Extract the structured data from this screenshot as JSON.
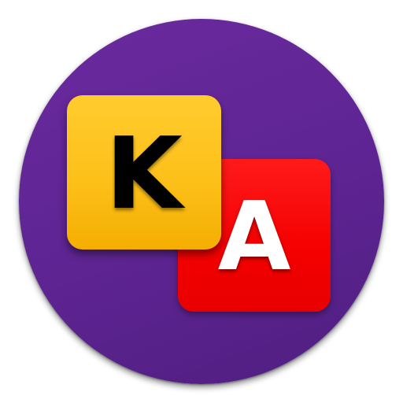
{
  "icon": {
    "letter_primary": "K",
    "letter_secondary": "A",
    "colors": {
      "background": "#5e2492",
      "tile_primary": "#fdc01a",
      "tile_secondary": "#f40000",
      "letter_primary": "#000000",
      "letter_secondary": "#ffffff"
    }
  }
}
